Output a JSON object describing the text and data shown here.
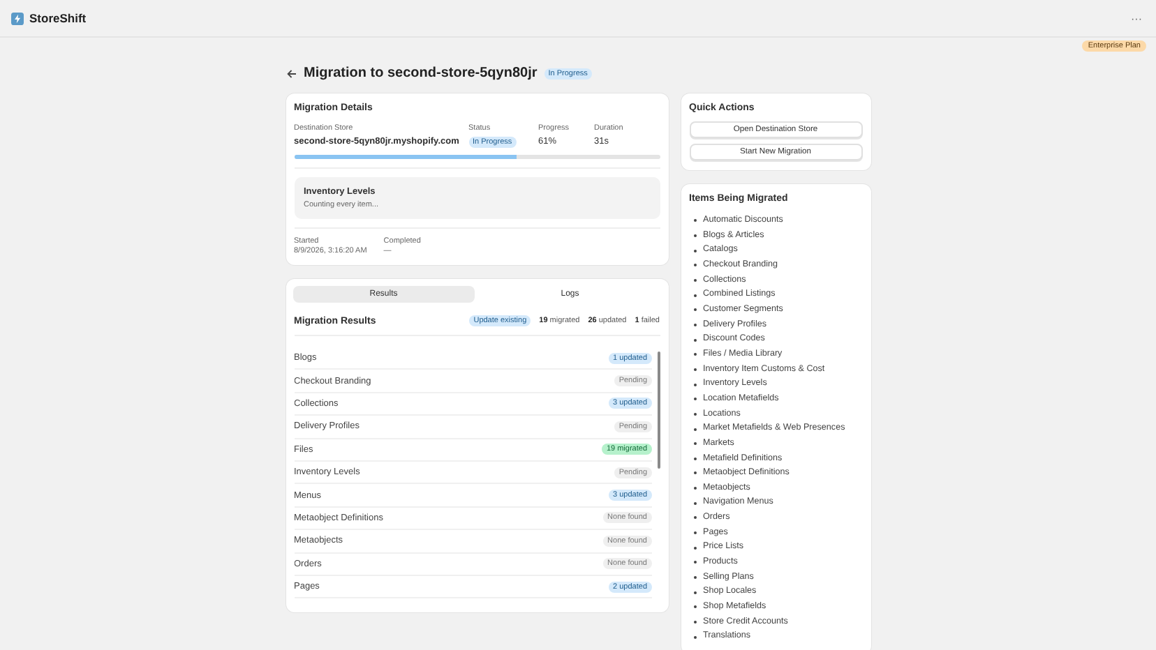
{
  "app": {
    "name": "StoreShift",
    "menu": "···",
    "plan": "Enterprise Plan"
  },
  "page": {
    "title": "Migration to second-store-5qyn80jr",
    "status": "In Progress"
  },
  "details": {
    "title": "Migration Details",
    "fields": [
      {
        "label": "Destination Store",
        "value": "second-store-5qyn80jr.myshopify.com",
        "kind": "text"
      },
      {
        "label": "Status",
        "value": "In Progress",
        "kind": "badge"
      },
      {
        "label": "Progress",
        "value": "61%",
        "kind": "text"
      },
      {
        "label": "Duration",
        "value": "31s",
        "kind": "text"
      }
    ],
    "progress": {
      "level": 0.61
    },
    "current": {
      "title": "Inventory Levels",
      "message": "Counting every item..."
    },
    "times": [
      {
        "label": "Started",
        "value": "8/9/2026, 3:16:20 AM"
      },
      {
        "label": "Completed",
        "value": "—"
      }
    ]
  },
  "tabs": [
    {
      "label": "Results",
      "selected": true
    },
    {
      "label": "Logs",
      "selected": false
    }
  ],
  "results": {
    "title": "Migration Results",
    "mode": "Update existing",
    "totals": [
      {
        "count": "19",
        "label": "migrated"
      },
      {
        "count": "26",
        "label": "updated"
      },
      {
        "count": "1",
        "label": "failed"
      }
    ],
    "rows": [
      {
        "name": "Blogs",
        "status": "1 updated",
        "kind": "updated"
      },
      {
        "name": "Checkout Branding",
        "status": "Pending",
        "kind": "pending"
      },
      {
        "name": "Collections",
        "status": "3 updated",
        "kind": "updated"
      },
      {
        "name": "Delivery Profiles",
        "status": "Pending",
        "kind": "pending"
      },
      {
        "name": "Files",
        "status": "19 migrated",
        "kind": "migrated"
      },
      {
        "name": "Inventory Levels",
        "status": "Pending",
        "kind": "pending"
      },
      {
        "name": "Menus",
        "status": "3 updated",
        "kind": "updated"
      },
      {
        "name": "Metaobject Definitions",
        "status": "None found",
        "kind": "none"
      },
      {
        "name": "Metaobjects",
        "status": "None found",
        "kind": "none"
      },
      {
        "name": "Orders",
        "status": "None found",
        "kind": "none"
      },
      {
        "name": "Pages",
        "status": "2 updated",
        "kind": "updated"
      }
    ]
  },
  "quick_actions": {
    "title": "Quick Actions",
    "buttons": [
      "Open Destination Store",
      "Start New Migration"
    ]
  },
  "items": {
    "title": "Items Being Migrated",
    "list": [
      "Automatic Discounts",
      "Blogs & Articles",
      "Catalogs",
      "Checkout Branding",
      "Collections",
      "Combined Listings",
      "Customer Segments",
      "Delivery Profiles",
      "Discount Codes",
      "Files / Media Library",
      "Inventory Item Customs & Cost",
      "Inventory Levels",
      "Location Metafields",
      "Locations",
      "Market Metafields & Web Presences",
      "Markets",
      "Metafield Definitions",
      "Metaobject Definitions",
      "Metaobjects",
      "Navigation Menus",
      "Orders",
      "Pages",
      "Price Lists",
      "Products",
      "Selling Plans",
      "Shop Locales",
      "Shop Metafields",
      "Store Credit Accounts",
      "Translations"
    ]
  }
}
